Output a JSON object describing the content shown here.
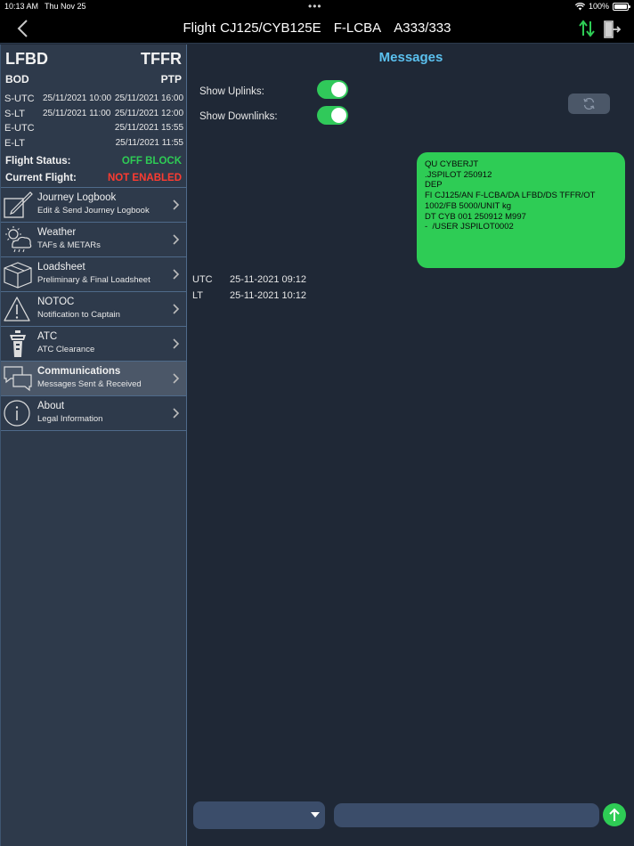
{
  "status_bar": {
    "time": "10:13 AM",
    "date": "Thu Nov 25",
    "battery": "100%"
  },
  "nav": {
    "flight_label": "Flight",
    "flight_number": "CJ125/CYB125E",
    "registration": "F-LCBA",
    "aircraft": "A333/333"
  },
  "flight": {
    "origin": "LFBD",
    "destination": "TFFR",
    "origin_code": "BOD",
    "destination_code": "PTP",
    "times": [
      {
        "label": "S-UTC",
        "dep": "25/11/2021 10:00",
        "arr": "25/11/2021 16:00"
      },
      {
        "label": "S-LT",
        "dep": "25/11/2021 11:00",
        "arr": "25/11/2021 12:00"
      },
      {
        "label": "E-UTC",
        "dep": "",
        "arr": "25/11/2021 15:55"
      },
      {
        "label": "E-LT",
        "dep": "",
        "arr": "25/11/2021 11:55"
      }
    ],
    "status_label": "Flight Status:",
    "status_value": "OFF BLOCK",
    "status_color": "#2ecc55",
    "current_label": "Current Flight:",
    "current_value": "NOT ENABLED",
    "current_color": "#ff3b30"
  },
  "menu": [
    {
      "title": "Journey Logbook",
      "subtitle": "Edit & Send Journey Logbook",
      "icon": "logbook-edit-icon"
    },
    {
      "title": "Weather",
      "subtitle": "TAFs & METARs",
      "icon": "weather-icon"
    },
    {
      "title": "Loadsheet",
      "subtitle": "Preliminary & Final Loadsheet",
      "icon": "loadsheet-box-icon"
    },
    {
      "title": "NOTOC",
      "subtitle": "Notification to Captain",
      "icon": "warning-triangle-icon"
    },
    {
      "title": "ATC",
      "subtitle": "ATC Clearance",
      "icon": "control-tower-icon"
    },
    {
      "title": "Communications",
      "subtitle": "Messages Sent & Received",
      "icon": "chat-bubbles-icon",
      "active": true
    },
    {
      "title": "About",
      "subtitle": "Legal Information",
      "icon": "info-icon"
    }
  ],
  "messages": {
    "title": "Messages",
    "show_uplinks_label": "Show Uplinks:",
    "show_uplinks": true,
    "show_downlinks_label": "Show Downlinks:",
    "show_downlinks": true,
    "message_lines": [
      "QU CYBERJT",
      ".JSPILOT 250912",
      "DEP",
      "FI CJ125/AN F-LCBA/DA LFBD/DS TFFR/OT",
      "1002/FB 5000/UNIT kg",
      "DT CYB 001 250912 M997",
      "-  /USER JSPILOT0002"
    ],
    "utc_label": "UTC",
    "utc_value": "25-11-2021 09:12",
    "lt_label": "LT",
    "lt_value": "25-11-2021 10:12"
  },
  "composer": {
    "dropdown_value": "",
    "input_placeholder": ""
  },
  "colors": {
    "accent": "#5bc1ef",
    "green": "#2ecc55",
    "background": "#1f2836",
    "sidebar": "#2e3a4b"
  }
}
